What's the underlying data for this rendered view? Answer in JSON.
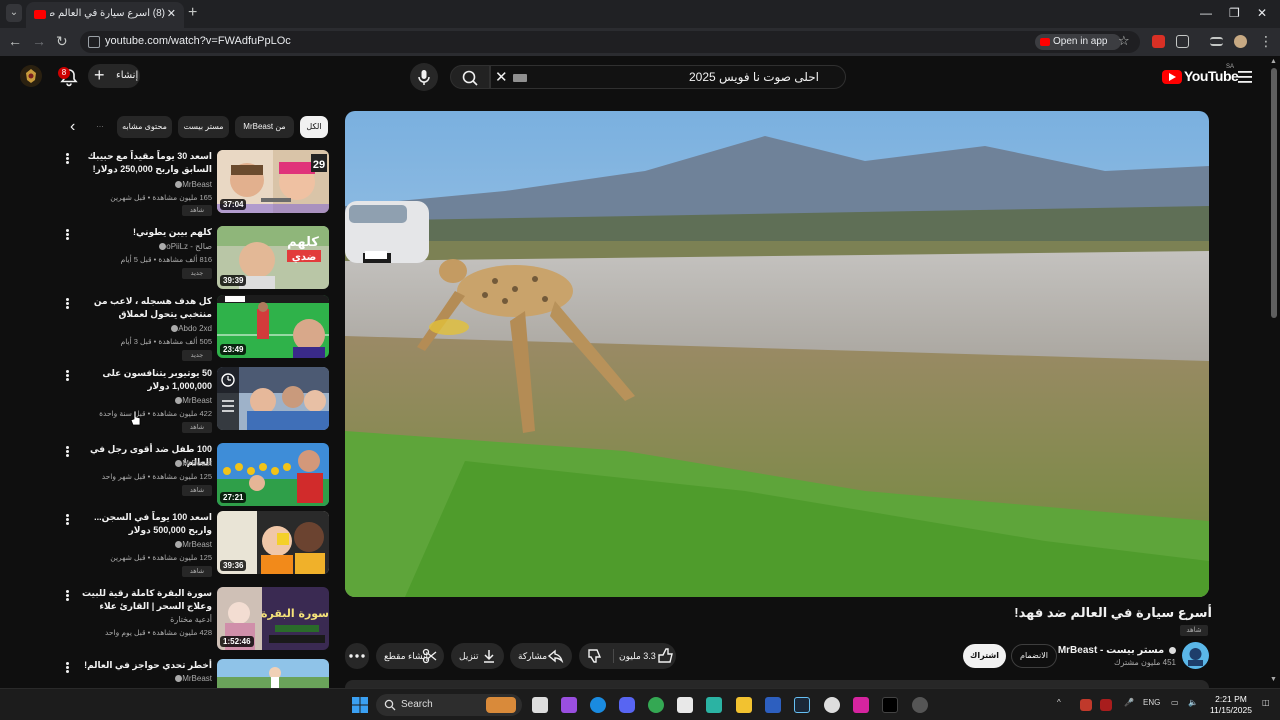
{
  "browser": {
    "tab_title": "(8) أسرع سيارة في العالم ضد",
    "url": "youtube.com/watch?v=FWAdfuPpLOc",
    "open_in_app": "Open in app"
  },
  "header": {
    "search_query": "احلى صوت نا فويس 2025",
    "create_label": "إنشاء",
    "notification_count": "8",
    "logo_text": "YouTube",
    "logo_country": "SA"
  },
  "chips": [
    "الكل",
    "من MrBeast",
    "مستر بيست",
    "محتوى مشابه"
  ],
  "related": [
    {
      "title": "اسعد 30 يوماً مقيداً مع حبيبك السابق واربح 250,000 دولار!",
      "channel": "MrBeast",
      "views": "165 مليون مشاهدة • قبل شهرين",
      "badge": "شاهد",
      "duration": "37:04"
    },
    {
      "title": "كلهم بيبن يطوني!",
      "channel": "صالح - oPiiLz",
      "views": "816 ألف مشاهدة • قبل 5 أيام",
      "badge": "جديد",
      "duration": "39:39"
    },
    {
      "title": "كل هدف هسجله ، لاعب من منتخبي يتحول لعملاق",
      "channel": "Abdo 2xd",
      "views": "505 ألف مشاهدة • قبل 3 أيام",
      "badge": "جديد",
      "duration": "23:49"
    },
    {
      "title": "50 يوتيوبر يتنافسون على 1,000,000 دولار",
      "channel": "MrBeast",
      "views": "422 مليون مشاهدة • قبل سنة واحدة",
      "badge": "شاهد",
      "duration": ""
    },
    {
      "title": "100 طفل ضد أقوى رجل في العالم!",
      "channel": "MrBeast",
      "views": "125 مليون مشاهدة • قبل شهر واحد",
      "badge": "شاهد",
      "duration": "27:21"
    },
    {
      "title": "اسعد 100 يوماً في السجن... واربح 500,000 دولار",
      "channel": "MrBeast",
      "views": "125 مليون مشاهدة • قبل شهرين",
      "badge": "شاهد",
      "duration": "39:36"
    },
    {
      "title": "سورة البقرة كاملة رقية للبيت وعلاج السحر | القارئ علاء عقل - Surah Al Baqarah",
      "channel": "أدعية مختارة",
      "views": "428 مليون مشاهدة • قبل يوم واحد",
      "badge": "",
      "duration": "1:52:46"
    },
    {
      "title": "أخطر تحدي حواجز في العالم!",
      "channel": "MrBeast",
      "views": "",
      "badge": "",
      "duration": ""
    }
  ],
  "video": {
    "title": "أسرع سيارة في العالم ضد فهد!",
    "featured_badge": "شاهد",
    "channel_name": "مستر بيست - MrBeast",
    "subscribers": "451 مليون مشترك",
    "join_label": "الانضمام",
    "subscribe_label": "اشتراك",
    "likes": "3.3 مليون",
    "share_label": "مشاركة",
    "download_label": "تنزيل",
    "clip_label": "إنشاء مقطع"
  },
  "taskbar": {
    "search_label": "Search",
    "lang": "ENG",
    "time": "2:21 PM",
    "date": "11/15/2025"
  },
  "colors": {
    "background": "#0f0f0f",
    "chip_bg": "#272727",
    "accent_red": "#ff0000",
    "text": "#f1f1f1",
    "muted": "#aaaaaa"
  }
}
